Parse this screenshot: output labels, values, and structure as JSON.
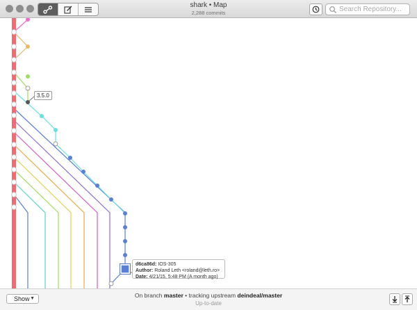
{
  "window": {
    "title": "shark • Map",
    "subtitle": "2,288 commits"
  },
  "toolbar": {
    "views": [
      {
        "name": "map-view-button",
        "icon": "branch-map-icon",
        "active": true
      },
      {
        "name": "edit-view-button",
        "icon": "compose-icon",
        "active": false
      },
      {
        "name": "list-view-button",
        "icon": "list-icon",
        "active": false
      }
    ],
    "history_icon": "history-icon",
    "search_placeholder": "Search Repository..."
  },
  "graph": {
    "tag_label": "3.5.0",
    "commit_card": {
      "sha": "d6ca86d:",
      "message": "IOS-305",
      "author_label": "Author:",
      "author": "Roland Leth <roland@leth.ro>",
      "date_label": "Date:",
      "date": "4/21/15, 5:48 PM (A month ago)"
    },
    "colors": {
      "master": "#ef6c73",
      "blue": "#5a7fd6",
      "violet": "#8c6fd1",
      "magenta": "#d45bc4",
      "orange": "#e9a94b",
      "yellow": "#e3cf58",
      "green": "#9edd63",
      "teal": "#5cd3c4",
      "cyan": "#6be0e0",
      "pink": "#f06cd0"
    }
  },
  "footer": {
    "show_label": "Show",
    "status_prefix": "On branch ",
    "branch": "master",
    "status_mid": " • tracking upstream ",
    "upstream": "deindeal/master",
    "status2": "Up-to-date",
    "pull_icon": "arrow-down-icon",
    "push_icon": "arrow-up-icon"
  }
}
